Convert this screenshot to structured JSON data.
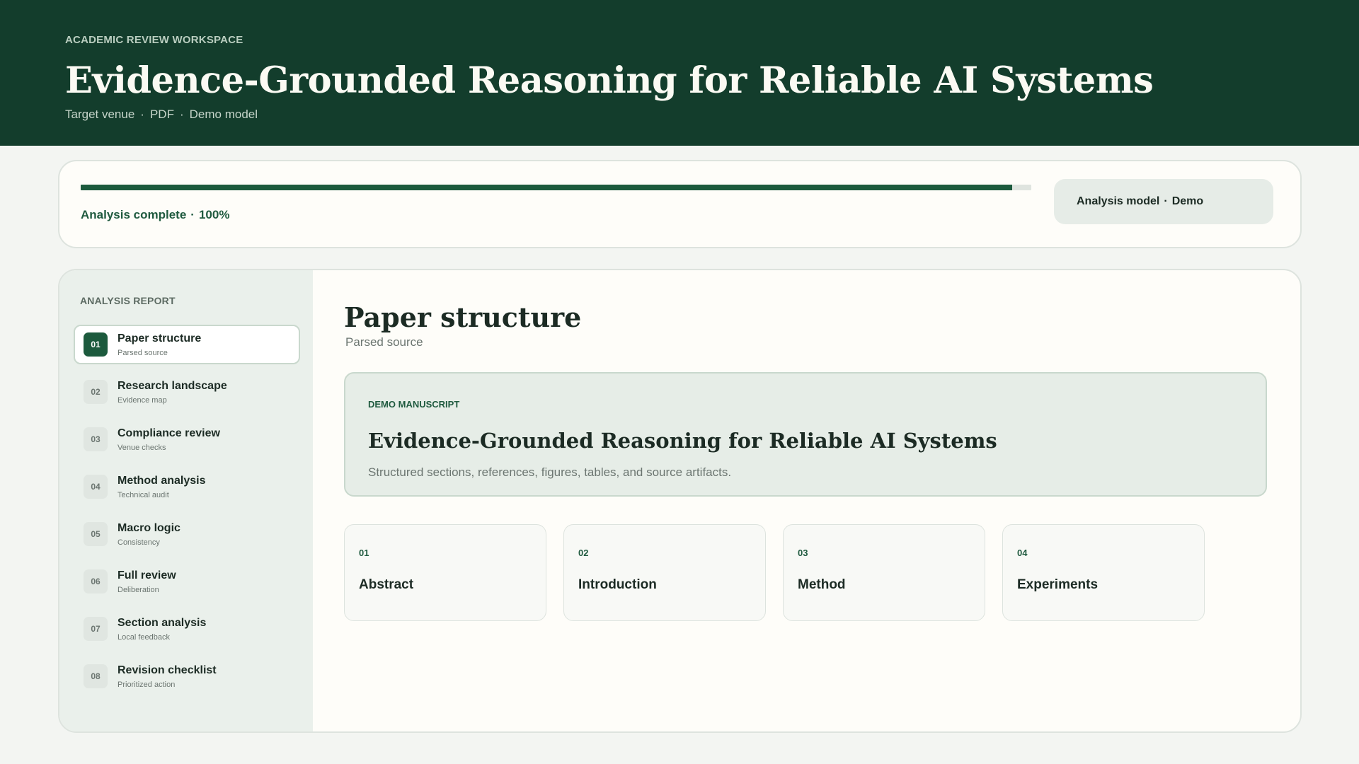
{
  "header": {
    "eyebrow": "ACADEMIC REVIEW WORKSPACE",
    "title": "Evidence-Grounded Reasoning for Reliable AI Systems",
    "meta": [
      "Target venue",
      "PDF",
      "Demo model"
    ]
  },
  "progress": {
    "status_label": "Analysis complete",
    "percent_text": "100%",
    "fill_fraction": 0.98,
    "model_label": "Analysis model",
    "model_value": "Demo"
  },
  "sidebar": {
    "heading": "ANALYSIS REPORT",
    "items": [
      {
        "num": "01",
        "label": "Paper structure",
        "sub": "Parsed source",
        "active": true
      },
      {
        "num": "02",
        "label": "Research landscape",
        "sub": "Evidence map",
        "active": false
      },
      {
        "num": "03",
        "label": "Compliance review",
        "sub": "Venue checks",
        "active": false
      },
      {
        "num": "04",
        "label": "Method analysis",
        "sub": "Technical audit",
        "active": false
      },
      {
        "num": "05",
        "label": "Macro logic",
        "sub": "Consistency",
        "active": false
      },
      {
        "num": "06",
        "label": "Full review",
        "sub": "Deliberation",
        "active": false
      },
      {
        "num": "07",
        "label": "Section analysis",
        "sub": "Local feedback",
        "active": false
      },
      {
        "num": "08",
        "label": "Revision checklist",
        "sub": "Prioritized action",
        "active": false
      }
    ]
  },
  "main": {
    "section_title": "Paper structure",
    "section_sub": "Parsed source",
    "manuscript": {
      "tag": "DEMO MANUSCRIPT",
      "title": "Evidence-Grounded Reasoning for Reliable AI Systems",
      "description": "Structured sections, references, figures, tables, and source artifacts."
    },
    "sections": [
      {
        "num": "01",
        "name": "Abstract"
      },
      {
        "num": "02",
        "name": "Introduction"
      },
      {
        "num": "03",
        "name": "Method"
      },
      {
        "num": "04",
        "name": "Experiments"
      }
    ]
  },
  "colors": {
    "header_bg": "#133d2c",
    "accent": "#1c5a3d",
    "page_bg": "#f3f5f2",
    "card_bg": "#fefdf9",
    "sidebar_bg": "#eaf0eb"
  }
}
